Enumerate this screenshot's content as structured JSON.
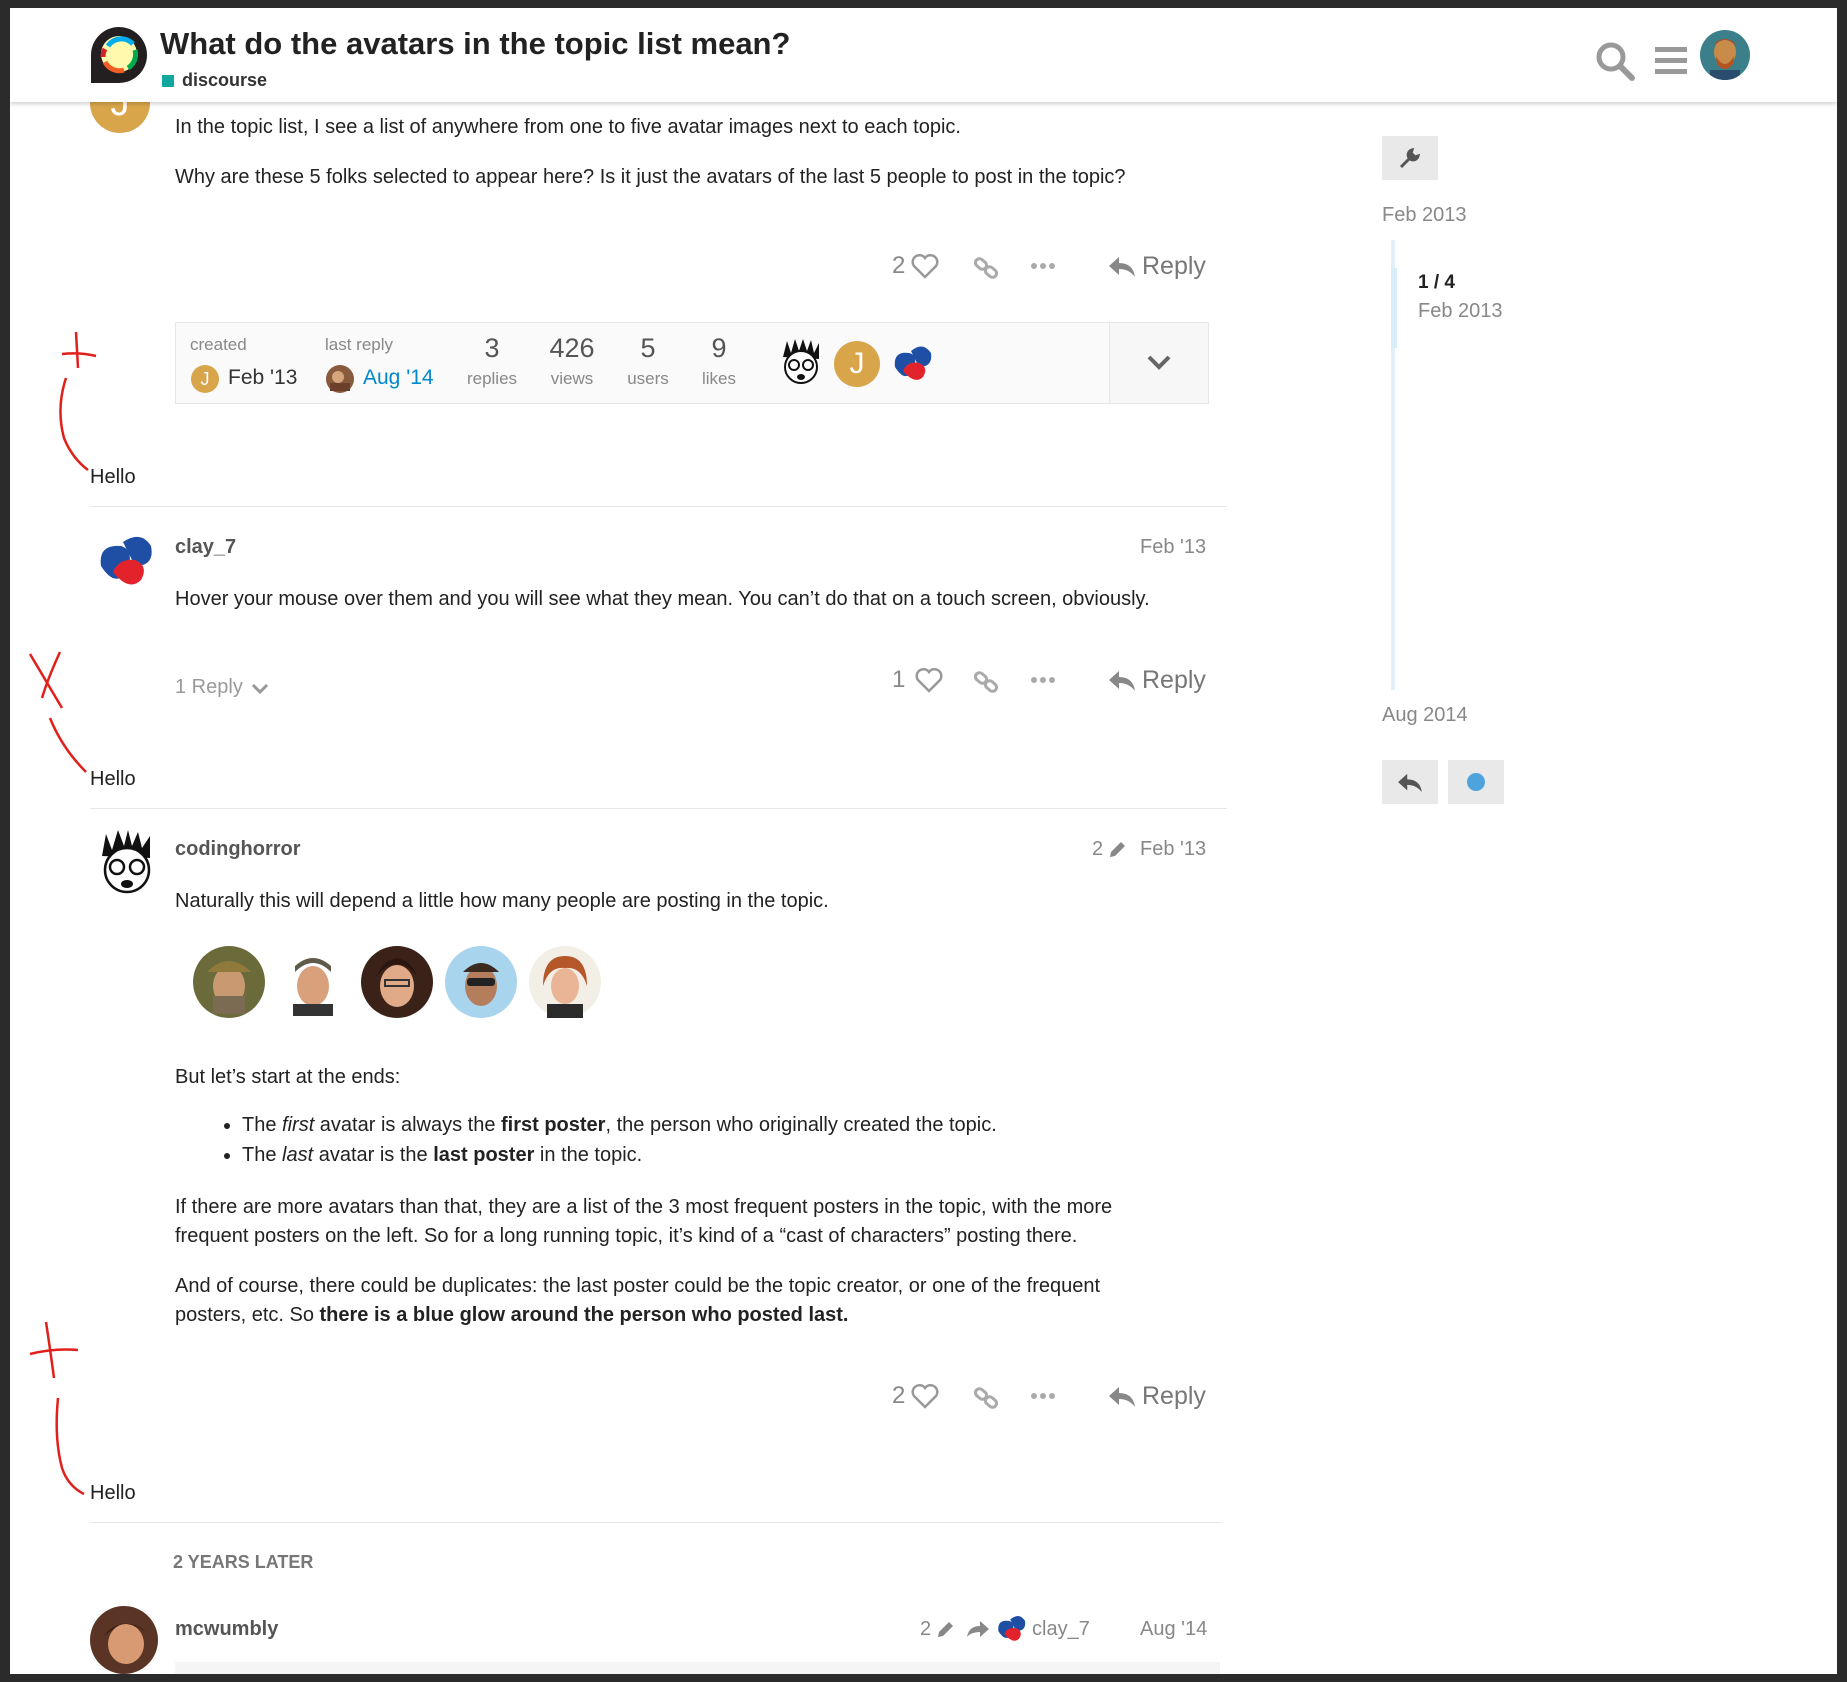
{
  "header": {
    "title": "What do the avatars in the topic list mean?",
    "category": "discourse",
    "category_color": "#12a89d"
  },
  "posts": [
    {
      "body": [
        "In the topic list, I see a list of anywhere from one to five avatar images next to each topic.",
        "Why are these 5 folks selected to appear here? Is it just the avatars of the last 5 people to post in the topic?"
      ],
      "likes": "2",
      "reply_label": "Reply"
    },
    {
      "username": "clay_7",
      "date": "Feb '13",
      "body": [
        "Hover your mouse over them and you will see what they mean. You can’t do that on a touch screen, obviously."
      ],
      "replies_toggle": "1 Reply",
      "likes": "1",
      "reply_label": "Reply"
    },
    {
      "username": "codinghorror",
      "edits": "2",
      "date": "Feb '13",
      "intro": "Naturally this will depend a little how many people are posting in the topic.",
      "start": "But let’s start at the ends:",
      "bullets": [
        {
          "a": "The ",
          "em": "first",
          "b": " avatar is always the ",
          "strong": "first poster",
          "c": ", the person who originally created the topic."
        },
        {
          "a": "The ",
          "em": "last",
          "b": " avatar is the ",
          "strong": "last poster",
          "c": " in the topic."
        }
      ],
      "para2_l1": "If there are more avatars than that, they are a list of the 3 most frequent posters in the topic, with the more",
      "para2_l2": "frequent posters on the left. So for a long running topic, it’s kind of a “cast of characters” posting there.",
      "para3_l1": "And of course, there could be duplicates: the last poster could be the topic creator, or one of the frequent",
      "para3_l2a": "posters, etc. So ",
      "para3_l2b": "there is a blue glow around the person who posted last.",
      "likes": "2",
      "reply_label": "Reply"
    },
    {
      "username": "mcwumbly",
      "edits": "2",
      "reply_to": "clay_7",
      "date": "Aug '14"
    }
  ],
  "summary": {
    "created_label": "created",
    "created_avatar_letter": "J",
    "created_date": "Feb '13",
    "last_reply_label": "last reply",
    "last_reply_date": "Aug '14",
    "stats": [
      {
        "value": "3",
        "label": "replies"
      },
      {
        "value": "426",
        "label": "views"
      },
      {
        "value": "5",
        "label": "users"
      },
      {
        "value": "9",
        "label": "likes"
      }
    ],
    "participant_letter": "J"
  },
  "annotations": {
    "hello": "Hello"
  },
  "time_gap": "2 YEARS LATER",
  "timeline": {
    "start_date": "Feb 2013",
    "position": "1 / 4",
    "position_date": "Feb 2013",
    "end_date": "Aug 2014"
  },
  "colors": {
    "link_blue": "#0088cc",
    "accent_j": "#d9a54b",
    "timeline_blue": "#e1f0fa",
    "annotation_red": "#e0201b"
  }
}
